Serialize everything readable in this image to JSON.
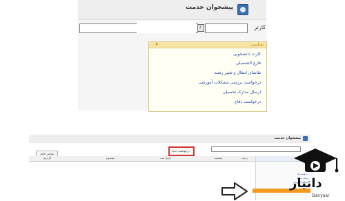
{
  "top_panel": {
    "title": "پیشخوان خدمت",
    "keyword_label": "کارتر",
    "keyword_value": "",
    "small_button_label": "?",
    "long_input_value": "",
    "menu": {
      "header": "شناسی",
      "items": [
        "کارت دانشجویی",
        "فارغ التحصیلی",
        "تقاضای انتقال و تغییر رشته",
        "درخواست بررسی مشکلات آموزشی",
        "ارسال مدارک تحصیلی",
        "درخواست دفاع"
      ]
    }
  },
  "bottom_panel": {
    "title": "پیشخوان خدمت",
    "highlight_label": "درخواست جدید",
    "toolbar_label": "نمایش کامل",
    "columns": [
      "گزارش",
      "موضوع",
      "تاریخ ثبت",
      "وضعیت",
      "ردیف"
    ],
    "side_links": [
      "درخواست ها",
      "ارسال مدارک",
      "مشکلات آموزشی"
    ]
  },
  "watermark": {
    "word": "دانیار",
    "latin": "Danyaar"
  },
  "colors": {
    "highlight": "#d33535",
    "menu_header": "#f8e4a5",
    "link": "#1f3fa8",
    "orange": "#f29a1d",
    "brand_blue": "#3a6fb0"
  }
}
